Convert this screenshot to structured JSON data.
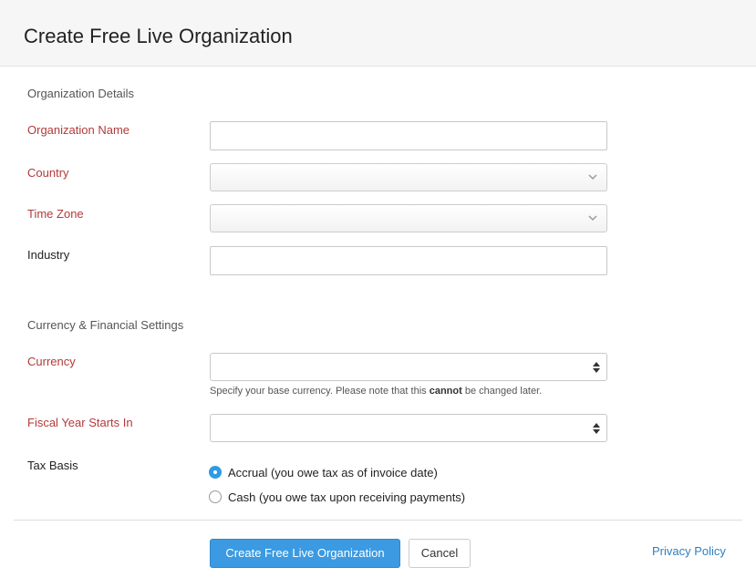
{
  "header": {
    "title": "Create Free Live Organization"
  },
  "sections": {
    "org_details": "Organization Details",
    "currency_settings": "Currency & Financial Settings"
  },
  "fields": {
    "org_name": {
      "label": "Organization Name",
      "value": ""
    },
    "country": {
      "label": "Country",
      "value": ""
    },
    "time_zone": {
      "label": "Time Zone",
      "value": ""
    },
    "industry": {
      "label": "Industry",
      "value": ""
    },
    "currency": {
      "label": "Currency",
      "value": ""
    },
    "currency_hint_pre": "Specify your base currency. Please note that this ",
    "currency_hint_bold": "cannot",
    "currency_hint_post": " be changed later.",
    "fiscal_year": {
      "label": "Fiscal Year Starts In",
      "value": ""
    },
    "tax_basis": {
      "label": "Tax Basis",
      "options": [
        {
          "label": "Accrual (you owe tax as of invoice date)",
          "checked": true
        },
        {
          "label": "Cash (you owe tax upon receiving payments)",
          "checked": false
        }
      ]
    }
  },
  "footer": {
    "create_label": "Create Free Live Organization",
    "cancel_label": "Cancel",
    "privacy_label": "Privacy Policy"
  },
  "icons": {
    "country_select": "chevron-down-icon",
    "timezone_select": "chevron-down-icon",
    "currency_select": "up-down-arrows-icon",
    "fiscal_select": "up-down-arrows-icon"
  },
  "colors": {
    "required_label": "#b33a3a",
    "primary_button": "#3b9ae1",
    "link": "#2f7fc1",
    "radio_checked": "#2f9be4"
  }
}
